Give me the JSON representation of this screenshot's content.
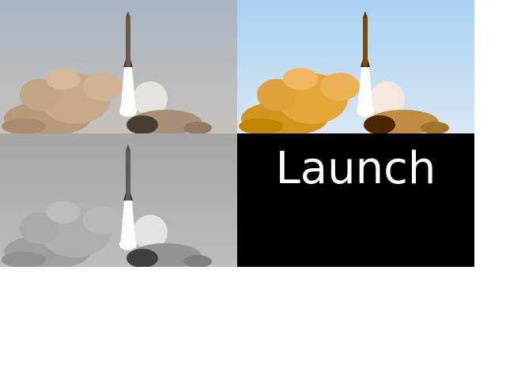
{
  "caption": "Launch",
  "panels": [
    {
      "id": "natural",
      "filter": "none"
    },
    {
      "id": "enhanced",
      "filter": "vivid"
    },
    {
      "id": "grayscale",
      "filter": "grayscale"
    }
  ],
  "colors": {
    "panel_bg": "#000000",
    "caption_text": "#ffffff",
    "page_bg": "#ffffff"
  }
}
